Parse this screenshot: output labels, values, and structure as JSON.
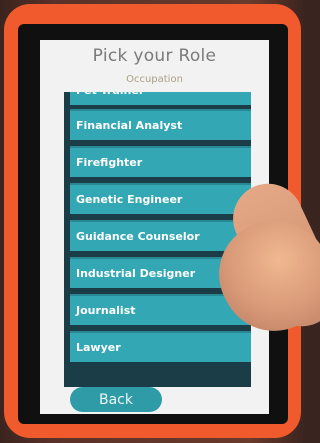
{
  "screen": {
    "title": "Pick your Role",
    "subtitle": "Occupation",
    "back_label": "Back"
  },
  "occupations": [
    "Pet Trainer",
    "Financial Analyst",
    "Firefighter",
    "Genetic Engineer",
    "Guidance Counselor",
    "Industrial Designer",
    "Journalist",
    "Lawyer"
  ],
  "colors": {
    "item_bg": "#33a7b4",
    "button_bg": "#2e9ba6",
    "tablet_case": "#f05a2c"
  }
}
